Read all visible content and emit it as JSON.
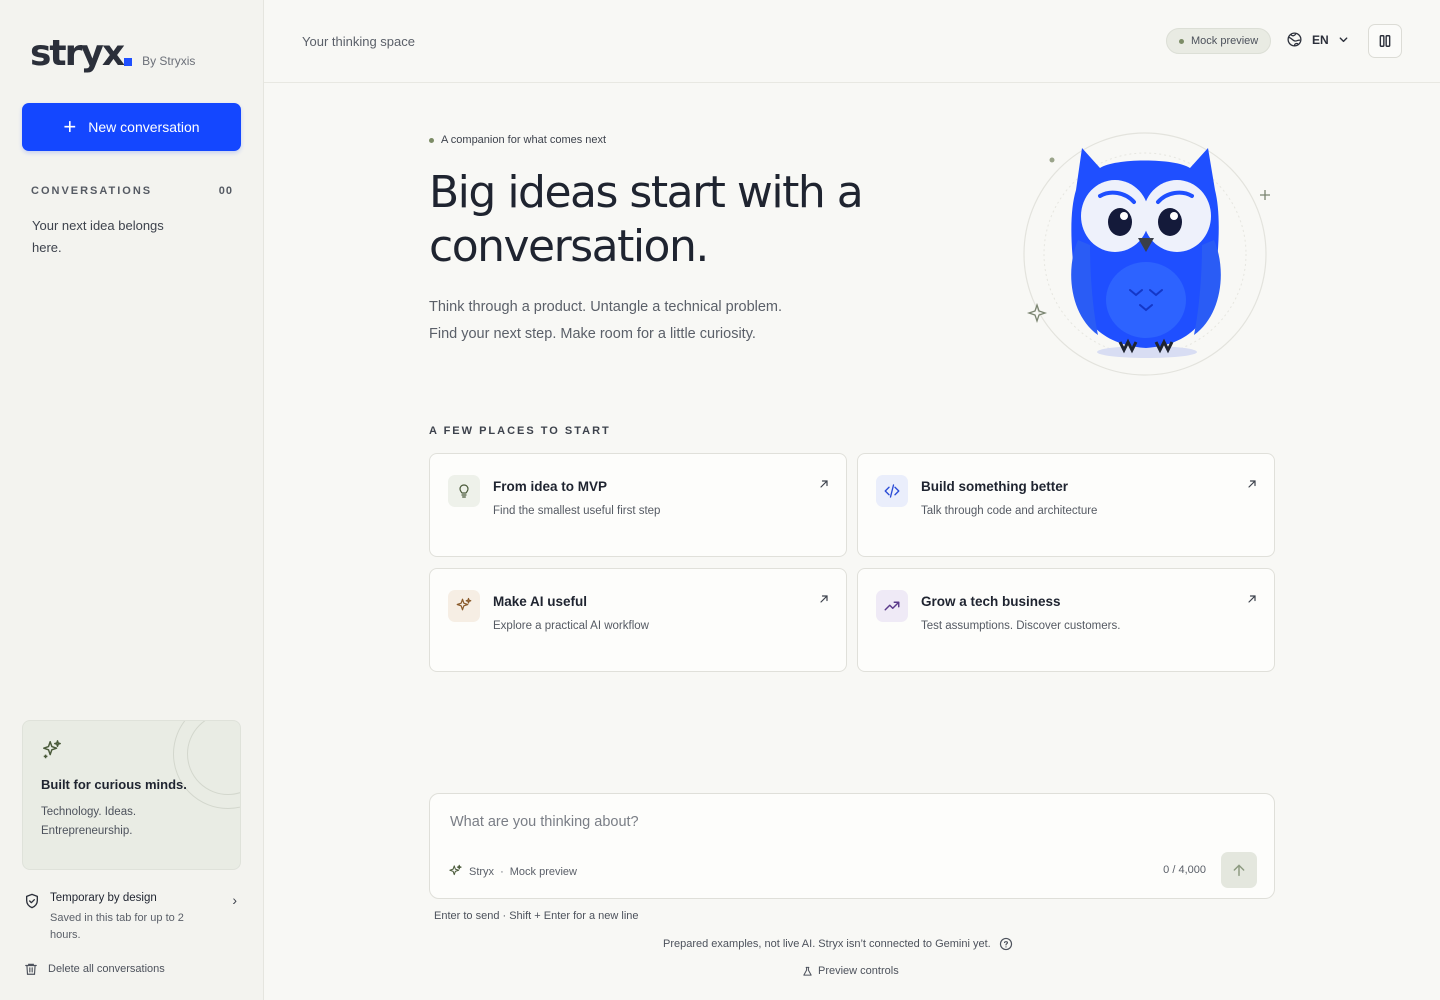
{
  "sidebar": {
    "logo_text": "stryx",
    "logo_by": "By Stryxis",
    "new_button_label": "New conversation",
    "conversations_label": "CONVERSATIONS",
    "conversations_count": "00",
    "empty_text": "Your next idea belongs here.",
    "promo": {
      "title": "Built for curious minds.",
      "body": "Technology. Ideas. Entrepreneurship."
    },
    "temporary": {
      "title": "Temporary by design",
      "body": "Saved in this tab for up to 2 hours."
    },
    "delete_label": "Delete all conversations"
  },
  "topbar": {
    "tagline": "Your thinking space",
    "mock_pill": "Mock preview",
    "language": "EN"
  },
  "hero": {
    "eyebrow": "A companion for what comes next",
    "headline": "Big ideas start with a conversation.",
    "subtitle": "Think through a product. Untangle a technical problem. Find your next step. Make room for a little curiosity."
  },
  "starters": {
    "label": "A FEW PLACES TO START",
    "cards": [
      {
        "title": "From idea to MVP",
        "desc": "Find the smallest useful first step",
        "icon": "lightbulb-icon"
      },
      {
        "title": "Build something better",
        "desc": "Talk through code and architecture",
        "icon": "code-icon"
      },
      {
        "title": "Make AI useful",
        "desc": "Explore a practical AI workflow",
        "icon": "sparkle-icon"
      },
      {
        "title": "Grow a tech business",
        "desc": "Test assumptions. Discover customers.",
        "icon": "trending-up-icon"
      }
    ]
  },
  "composer": {
    "placeholder": "What are you thinking about?",
    "model": "Stryx",
    "separator": "·",
    "mode": "Mock preview",
    "char_count": "0 / 4,000",
    "hint": "Enter to send · Shift + Enter for a new line"
  },
  "footer": {
    "disclaimer": "Prepared examples, not live AI. Stryx isn’t connected to Gemini yet.",
    "preview_controls": "Preview controls"
  },
  "colors": {
    "accent": "#1447ff",
    "owl_blue": "#1f4fff",
    "background": "#f8f8f5",
    "sidebar_bg": "#f3f3ef"
  }
}
